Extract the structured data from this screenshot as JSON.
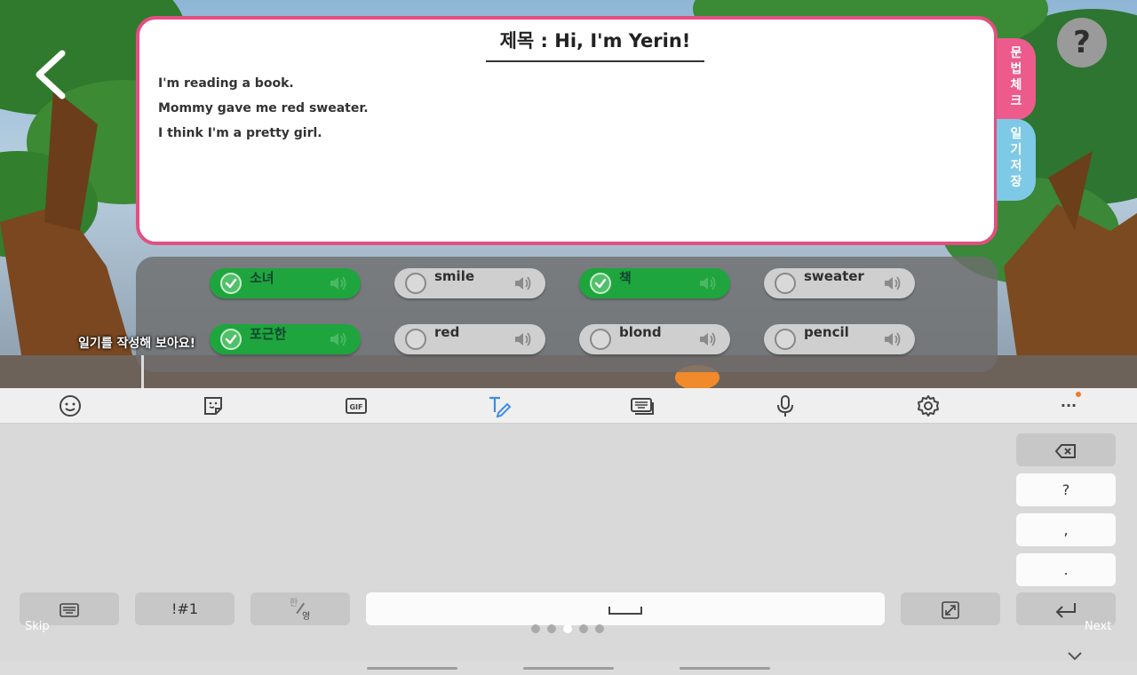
{
  "diary": {
    "title": "제목 : Hi, I'm Yerin!",
    "lines": [
      "I'm reading a book.",
      "Mommy gave me red sweater.",
      "I think I'm a pretty girl."
    ]
  },
  "side_tabs": {
    "grammar": [
      "문",
      "법",
      "체",
      "크"
    ],
    "save": [
      "일",
      "기",
      "저",
      "장"
    ]
  },
  "help": {
    "label": "?"
  },
  "words": [
    {
      "label": "소녀",
      "checked": true
    },
    {
      "label": "smile",
      "checked": false
    },
    {
      "label": "책",
      "checked": true
    },
    {
      "label": "sweater",
      "checked": false
    },
    {
      "label": "포근한",
      "checked": true
    },
    {
      "label": "red",
      "checked": false
    },
    {
      "label": "blond",
      "checked": false
    },
    {
      "label": "pencil",
      "checked": false
    }
  ],
  "hint": {
    "text": "일기를 작성해 보아요!"
  },
  "toolbar": {
    "icons": [
      "emoji-icon",
      "sticker-icon",
      "gif-icon",
      "handwriting-icon",
      "keyboard-mode-icon",
      "microphone-icon",
      "settings-icon",
      "more-icon"
    ],
    "gif_label": "GIF",
    "more_label": "···"
  },
  "keyboard": {
    "question": "?",
    "comma": ",",
    "period": ".",
    "symbols": "!#1",
    "lang_top": "한",
    "lang_bottom": "영"
  },
  "tutorial": {
    "skip": "Skip",
    "next": "Next",
    "page_count": 5,
    "active_page": 2
  },
  "colors": {
    "card_border": "#e24f82",
    "grammar_tab": "#ec5b8c",
    "save_tab": "#7ec9e6",
    "chip_checked": "#1fa53d",
    "accent_icon": "#3d8ee8"
  }
}
